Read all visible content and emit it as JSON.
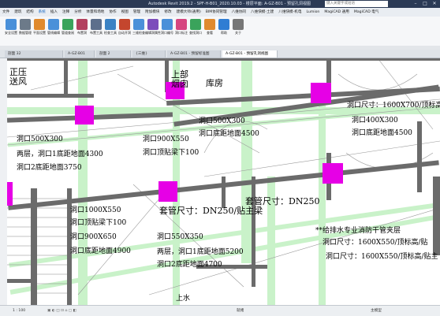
{
  "titlebar": {
    "title": "Autodesk Revit 2019.2 - SPF-H-B01_2020.10.03 - 楼层平面: A-GZ-B01 - 预留孔洞视图",
    "search_placeholder": "键入关键字或短语"
  },
  "menu": [
    "文件",
    "建筑",
    "结构",
    "系统",
    "插入",
    "注释",
    "分析",
    "体量和场地",
    "协作",
    "视图",
    "管理",
    "附加模块",
    "修改",
    "建模大师(通用)",
    "BIM协同管理",
    "八维协同",
    "八维快模-土建",
    "八维快模-机电",
    "Lumion",
    "MagiCAD 通用",
    "MagiCAD 电气"
  ],
  "active_menu": "系统",
  "ribbon_tools": [
    {
      "label": "安全设置",
      "color": "#4a90d9"
    },
    {
      "label": "数据管理",
      "color": "#6c7a89"
    },
    {
      "label": "平面设置",
      "color": "#e08a2e"
    },
    {
      "label": "管线编辑",
      "color": "#4a90d9"
    },
    {
      "label": "管道查阅",
      "color": "#3aa35b"
    },
    {
      "label": "布置洞",
      "color": "#b3415f"
    },
    {
      "label": "布置工具",
      "color": "#5d6f8c"
    },
    {
      "label": "检查工具",
      "color": "#3b82c4"
    },
    {
      "label": "自动开洞",
      "color": "#c4462e"
    },
    {
      "label": "三维检查",
      "color": "#4a90d9"
    },
    {
      "label": "编辑洞属性",
      "color": "#7c4dbb"
    },
    {
      "label": "洞口编号",
      "color": "#4a90d9"
    },
    {
      "label": "洞口标注",
      "color": "#d64580"
    },
    {
      "label": "查找洞口",
      "color": "#3aa35b"
    },
    {
      "label": "查看",
      "color": "#e08a2e"
    },
    {
      "label": "帮助",
      "color": "#2f7dd3"
    },
    {
      "label": "关于",
      "color": "#777777"
    }
  ],
  "tabs": [
    {
      "label": "剖面 32",
      "active": false
    },
    {
      "label": "A-GZ-B01",
      "active": false
    },
    {
      "label": "剖面 2",
      "active": false
    },
    {
      "label": "{三维}",
      "active": false
    },
    {
      "label": "A-GZ-B01 - 预留标准图",
      "active": false
    },
    {
      "label": "A-GZ-B01 - 预留孔洞视图",
      "active": true
    }
  ],
  "drawing": {
    "room_zhengya": "正压\n送风",
    "room_shangbu": "上部\n烟囱",
    "room_kufang": "库房",
    "sleeve_dn250_a": "套管尺寸：DN250/贴主梁",
    "sleeve_dn250_b": "套管尺寸：DN250",
    "dim_1600x700": "洞口尺寸：1600X700/顶标高/贴主梁",
    "open_500x300": "洞口500X300",
    "two_layers_4300": "两层，洞口1底距地面4300",
    "bottom_3750": "洞口2底距地面3750",
    "open_900x550": "洞口900X550",
    "top_beam_100": "洞口顶贴梁下100",
    "open_500x300_b": "洞口500X300",
    "bottom_4500": "洞口底距地面4500",
    "open_400x300": "洞口400X300",
    "bottom_4500_b": "洞口底距地面4500",
    "open_1000x550": "洞口1000X550",
    "top_beam_100_b": "洞口顶贴梁下100",
    "open_900x650": "洞口900X650",
    "bottom_4900": "洞口底距地面4900",
    "open_550x350": "洞口550X350",
    "two_layers_5200": "两层，洞口1底距地面5200",
    "bottom_4700": "洞口2底距地面4700",
    "water_note": "**给排水专业消防干管夹层",
    "dim_1600x550_a": "洞口尺寸：1600X550/顶标高/贴",
    "dim_1600x550_b": "洞口尺寸：1600X550/顶标高/贴主",
    "shangshui": "上水"
  },
  "colors": {
    "highlight": "#e600e6",
    "pipe": "#c9f2c9",
    "wall": "#6b6b6b"
  },
  "status": {
    "scale": "1 : 100",
    "ready": "就绪",
    "workset": "主模型"
  }
}
